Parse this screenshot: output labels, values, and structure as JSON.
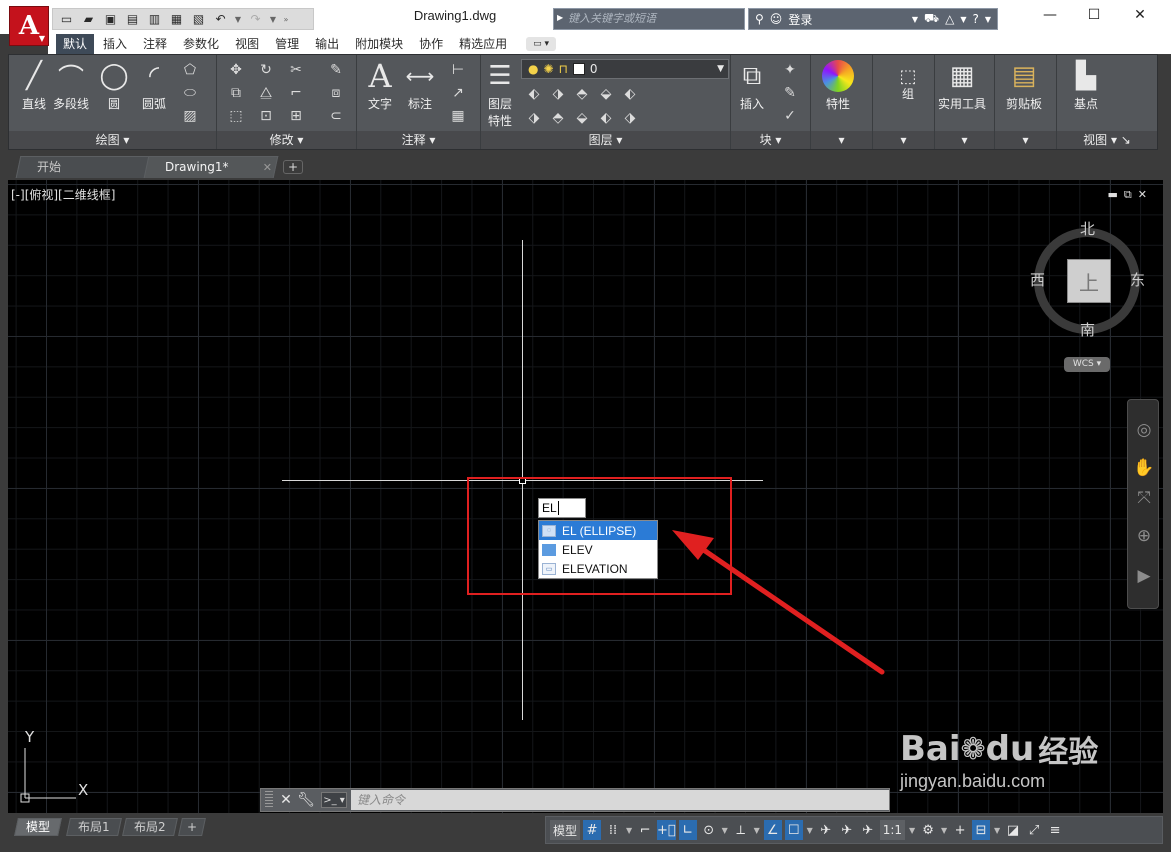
{
  "window": {
    "document_title": "Drawing1.dwg",
    "search_placeholder": "键入关键字或短语",
    "login_label": "登录"
  },
  "ribbon_tabs": [
    "默认",
    "插入",
    "注释",
    "参数化",
    "视图",
    "管理",
    "输出",
    "附加模块",
    "协作",
    "精选应用"
  ],
  "active_ribbon_tab": "默认",
  "ribbon": {
    "draw": {
      "line": "直线",
      "polyline": "多段线",
      "circle": "圆",
      "arc": "圆弧",
      "footer": "绘图 ▾"
    },
    "modify": {
      "footer": "修改 ▾"
    },
    "annotation": {
      "text": "文字",
      "dimension": "标注",
      "footer": "注释 ▾"
    },
    "layers": {
      "properties": "图层",
      "properties2": "特性",
      "current_layer": "0",
      "footer": "图层 ▾"
    },
    "block": {
      "insert": "插入",
      "footer": "块 ▾"
    },
    "properties": {
      "label": "特性"
    },
    "group": {
      "label": "组"
    },
    "utilities": {
      "label": "实用工具"
    },
    "clipboard": {
      "label": "剪贴板"
    },
    "view": {
      "base": "基点",
      "footer": "视图 ▾ ↘"
    }
  },
  "file_tabs": {
    "start": "开始",
    "drawing": "Drawing1*"
  },
  "viewport": {
    "label": "[-][俯视][二维线框]",
    "compass": {
      "north": "北",
      "south": "南",
      "east": "东",
      "west": "西",
      "top_face": "上"
    },
    "wcs": "WCS ▾"
  },
  "dynamic_input": {
    "typed": "EL",
    "suggestions": [
      {
        "label": "EL (ELLIPSE)",
        "icon": "ellipse-icon",
        "selected": true
      },
      {
        "label": "ELEV",
        "icon": "elev-icon",
        "selected": false
      },
      {
        "label": "ELEVATION",
        "icon": "elevation-icon",
        "selected": false
      }
    ]
  },
  "ucs": {
    "x": "X",
    "y": "Y"
  },
  "command_line": {
    "placeholder": "键入命令"
  },
  "layout_tabs": [
    "模型",
    "布局1",
    "布局2"
  ],
  "status_bar": {
    "model_label": "模型",
    "scale_label": "1:1"
  },
  "watermark": {
    "brand": "Bai",
    "brand2": "du",
    "brand_cn": "经验",
    "url": "jingyan.baidu.com"
  },
  "colors": {
    "annotation_red": "#e02020",
    "highlight_blue": "#2b7bd6",
    "autocad_red": "#c4121c"
  }
}
